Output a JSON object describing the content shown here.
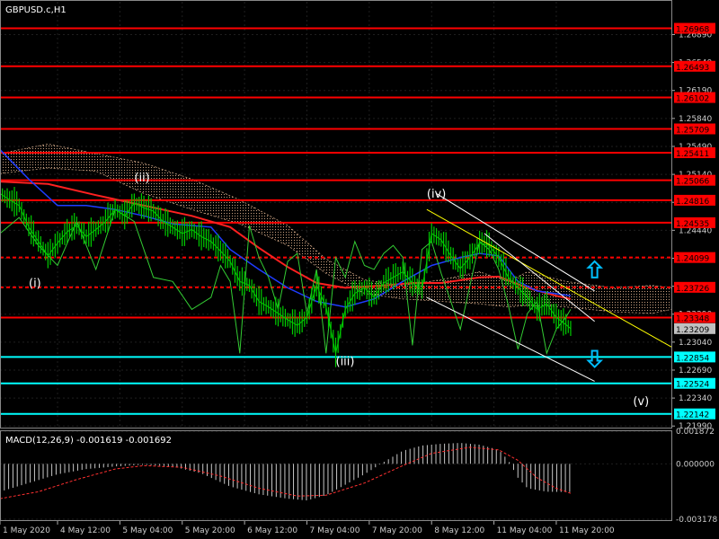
{
  "chart_data": [
    {
      "type": "line",
      "title": "GBPUSD.c,H1",
      "ylim": [
        1.2197,
        1.273
      ],
      "y_ticks": [
        1.2689,
        1.2654,
        1.2619,
        1.2584,
        1.2549,
        1.2514,
        1.2479,
        1.2444,
        1.2409,
        1.2374,
        1.2339,
        1.2304,
        1.2269,
        1.2234,
        1.2199
      ],
      "price_levels": {
        "red": [
          1.26968,
          1.26493,
          1.26102,
          1.25709,
          1.25411,
          1.25066,
          1.24816,
          1.24535,
          1.24099,
          1.23726,
          1.23348
        ],
        "cyan": [
          1.22854,
          1.22524,
          1.22142
        ]
      },
      "current_price": 1.23209,
      "wave_labels": [
        {
          "text": "(i)",
          "x": 6,
          "y": 1.2373
        },
        {
          "text": "(ii)",
          "x": 28,
          "y": 1.2505
        },
        {
          "text": "(iii)",
          "x": 70,
          "y": 1.2275
        },
        {
          "text": "(iv)",
          "x": 89,
          "y": 1.2485
        },
        {
          "text": "(v)",
          "x": 132,
          "y": 1.2225
        }
      ],
      "arrows": [
        {
          "direction": "up",
          "x": 124,
          "y": 1.2395
        },
        {
          "direction": "down",
          "x": 124,
          "y": 1.2283
        }
      ],
      "price_series": [
        [
          0,
          1.249
        ],
        [
          2,
          1.2482
        ],
        [
          4,
          1.2475
        ],
        [
          6,
          1.2448
        ],
        [
          8,
          1.243
        ],
        [
          10,
          1.2412
        ],
        [
          12,
          1.2428
        ],
        [
          14,
          1.2442
        ],
        [
          16,
          1.245
        ],
        [
          18,
          1.2436
        ],
        [
          20,
          1.2445
        ],
        [
          22,
          1.2455
        ],
        [
          24,
          1.247
        ],
        [
          26,
          1.2462
        ],
        [
          28,
          1.2478
        ],
        [
          30,
          1.2472
        ],
        [
          32,
          1.2468
        ],
        [
          34,
          1.2455
        ],
        [
          36,
          1.2448
        ],
        [
          38,
          1.244
        ],
        [
          40,
          1.2445
        ],
        [
          42,
          1.2436
        ],
        [
          44,
          1.243
        ],
        [
          46,
          1.2418
        ],
        [
          48,
          1.2405
        ],
        [
          50,
          1.238
        ],
        [
          52,
          1.2375
        ],
        [
          54,
          1.2355
        ],
        [
          56,
          1.2348
        ],
        [
          58,
          1.234
        ],
        [
          60,
          1.2332
        ],
        [
          62,
          1.2325
        ],
        [
          64,
          1.2335
        ],
        [
          66,
          1.2375
        ],
        [
          68,
          1.2348
        ],
        [
          70,
          1.229
        ],
        [
          72,
          1.2345
        ],
        [
          74,
          1.2365
        ],
        [
          76,
          1.2372
        ],
        [
          78,
          1.236
        ],
        [
          80,
          1.2378
        ],
        [
          82,
          1.2385
        ],
        [
          84,
          1.2392
        ],
        [
          86,
          1.2378
        ],
        [
          88,
          1.237
        ],
        [
          90,
          1.244
        ],
        [
          92,
          1.2432
        ],
        [
          94,
          1.2412
        ],
        [
          96,
          1.2396
        ],
        [
          98,
          1.241
        ],
        [
          100,
          1.2428
        ],
        [
          102,
          1.2425
        ],
        [
          104,
          1.241
        ],
        [
          106,
          1.2385
        ],
        [
          108,
          1.2372
        ],
        [
          110,
          1.236
        ],
        [
          112,
          1.2345
        ],
        [
          114,
          1.2352
        ],
        [
          116,
          1.2335
        ],
        [
          118,
          1.2326
        ],
        [
          119,
          1.2321
        ]
      ],
      "osc_series": [
        [
          0,
          1.244
        ],
        [
          4,
          1.246
        ],
        [
          8,
          1.2425
        ],
        [
          12,
          1.24
        ],
        [
          16,
          1.2455
        ],
        [
          20,
          1.2395
        ],
        [
          24,
          1.247
        ],
        [
          28,
          1.2455
        ],
        [
          32,
          1.2385
        ],
        [
          36,
          1.238
        ],
        [
          40,
          1.2345
        ],
        [
          44,
          1.236
        ],
        [
          46,
          1.24
        ],
        [
          48,
          1.238
        ],
        [
          50,
          1.229
        ],
        [
          52,
          1.245
        ],
        [
          54,
          1.241
        ],
        [
          56,
          1.2385
        ],
        [
          58,
          1.2345
        ],
        [
          60,
          1.2405
        ],
        [
          62,
          1.2415
        ],
        [
          64,
          1.234
        ],
        [
          66,
          1.2395
        ],
        [
          68,
          1.229
        ],
        [
          70,
          1.241
        ],
        [
          72,
          1.2385
        ],
        [
          74,
          1.243
        ],
        [
          76,
          1.24
        ],
        [
          78,
          1.2395
        ],
        [
          80,
          1.2415
        ],
        [
          82,
          1.2425
        ],
        [
          84,
          1.241
        ],
        [
          86,
          1.23
        ],
        [
          88,
          1.242
        ],
        [
          90,
          1.243
        ],
        [
          92,
          1.239
        ],
        [
          94,
          1.2355
        ],
        [
          96,
          1.232
        ],
        [
          98,
          1.2375
        ],
        [
          100,
          1.243
        ],
        [
          102,
          1.242
        ],
        [
          104,
          1.2395
        ],
        [
          106,
          1.235
        ],
        [
          108,
          1.2295
        ],
        [
          110,
          1.234
        ],
        [
          112,
          1.2355
        ],
        [
          114,
          1.229
        ],
        [
          116,
          1.232
        ],
        [
          118,
          1.2335
        ],
        [
          119,
          1.2345
        ]
      ],
      "ma_slow": [
        [
          0,
          1.2505
        ],
        [
          10,
          1.2502
        ],
        [
          20,
          1.2488
        ],
        [
          30,
          1.2475
        ],
        [
          40,
          1.2462
        ],
        [
          48,
          1.2448
        ],
        [
          54,
          1.2422
        ],
        [
          60,
          1.2398
        ],
        [
          66,
          1.2378
        ],
        [
          72,
          1.2372
        ],
        [
          80,
          1.2375
        ],
        [
          86,
          1.2378
        ],
        [
          92,
          1.2378
        ],
        [
          100,
          1.2385
        ],
        [
          104,
          1.2386
        ],
        [
          110,
          1.2372
        ],
        [
          116,
          1.2362
        ],
        [
          119,
          1.2358
        ]
      ],
      "ma_fast": [
        [
          0,
          1.2545
        ],
        [
          6,
          1.2508
        ],
        [
          12,
          1.2475
        ],
        [
          18,
          1.2475
        ],
        [
          24,
          1.247
        ],
        [
          30,
          1.2462
        ],
        [
          36,
          1.2452
        ],
        [
          44,
          1.2448
        ],
        [
          48,
          1.242
        ],
        [
          54,
          1.2395
        ],
        [
          60,
          1.2372
        ],
        [
          66,
          1.2355
        ],
        [
          72,
          1.2348
        ],
        [
          78,
          1.2358
        ],
        [
          84,
          1.238
        ],
        [
          90,
          1.24
        ],
        [
          96,
          1.241
        ],
        [
          100,
          1.2415
        ],
        [
          104,
          1.2412
        ],
        [
          108,
          1.238
        ],
        [
          112,
          1.2368
        ],
        [
          119,
          1.2362
        ]
      ],
      "cloud_a": [
        [
          0,
          1.254
        ],
        [
          10,
          1.2552
        ],
        [
          20,
          1.254
        ],
        [
          30,
          1.2528
        ],
        [
          40,
          1.2508
        ],
        [
          50,
          1.2482
        ],
        [
          60,
          1.245
        ],
        [
          68,
          1.2408
        ],
        [
          76,
          1.2382
        ],
        [
          84,
          1.2375
        ],
        [
          92,
          1.2382
        ],
        [
          100,
          1.2392
        ],
        [
          106,
          1.238
        ],
        [
          110,
          1.2392
        ],
        [
          118,
          1.238
        ],
        [
          128,
          1.2372
        ],
        [
          136,
          1.2375
        ],
        [
          140,
          1.2372
        ]
      ],
      "cloud_b": [
        [
          0,
          1.2515
        ],
        [
          10,
          1.2522
        ],
        [
          20,
          1.2518
        ],
        [
          30,
          1.249
        ],
        [
          40,
          1.247
        ],
        [
          50,
          1.2452
        ],
        [
          60,
          1.2425
        ],
        [
          68,
          1.239
        ],
        [
          76,
          1.2365
        ],
        [
          84,
          1.2358
        ],
        [
          92,
          1.2355
        ],
        [
          100,
          1.2352
        ],
        [
          106,
          1.2348
        ],
        [
          110,
          1.235
        ],
        [
          118,
          1.2348
        ],
        [
          128,
          1.2342
        ],
        [
          136,
          1.234
        ],
        [
          140,
          1.2345
        ]
      ],
      "channels": [
        {
          "color": "#ffff00",
          "from": [
            89,
            1.247
          ],
          "to": [
            140,
            1.2298
          ]
        },
        {
          "color": "#ffffff",
          "from": [
            91,
            1.249
          ],
          "to": [
            124,
            1.2368
          ]
        },
        {
          "color": "#ffffff",
          "from": [
            101,
            1.244
          ],
          "to": [
            124,
            1.233
          ]
        },
        {
          "color": "#ffffff",
          "from": [
            89,
            1.236
          ],
          "to": [
            124,
            1.2255
          ]
        }
      ]
    },
    {
      "type": "bar",
      "title": "MACD(12,26,9) -0.001619 -0.001692",
      "ylim": [
        -0.003178,
        0.001872
      ],
      "y_ticks": [
        0.001872,
        0.0,
        -0.003178
      ],
      "y_tick_labels": [
        "0.001872",
        "0.000000",
        "-0.003178"
      ],
      "macd": [
        [
          0,
          -0.0016
        ],
        [
          6,
          -0.0011
        ],
        [
          12,
          -0.0006
        ],
        [
          18,
          -0.0003
        ],
        [
          24,
          -0.00015
        ],
        [
          30,
          -5e-05
        ],
        [
          36,
          -0.00015
        ],
        [
          42,
          -0.00055
        ],
        [
          48,
          -0.0013
        ],
        [
          54,
          -0.00175
        ],
        [
          60,
          -0.002
        ],
        [
          64,
          -0.0021
        ],
        [
          68,
          -0.0018
        ],
        [
          72,
          -0.0012
        ],
        [
          76,
          -0.0006
        ],
        [
          80,
          0.0001
        ],
        [
          84,
          0.00075
        ],
        [
          88,
          0.00105
        ],
        [
          92,
          0.00115
        ],
        [
          96,
          0.0012
        ],
        [
          100,
          0.0011
        ],
        [
          104,
          0.0008
        ],
        [
          106,
          0.0002
        ],
        [
          108,
          -0.0008
        ],
        [
          110,
          -0.0014
        ],
        [
          114,
          -0.0016
        ],
        [
          119,
          -0.00162
        ]
      ],
      "signal": [
        [
          0,
          -0.002
        ],
        [
          8,
          -0.0016
        ],
        [
          16,
          -0.0009
        ],
        [
          24,
          -0.0003
        ],
        [
          30,
          -0.0001
        ],
        [
          38,
          -0.0002
        ],
        [
          46,
          -0.0007
        ],
        [
          54,
          -0.0014
        ],
        [
          62,
          -0.00185
        ],
        [
          68,
          -0.0018
        ],
        [
          76,
          -0.0011
        ],
        [
          84,
          -0.0001
        ],
        [
          90,
          0.0006
        ],
        [
          98,
          0.00095
        ],
        [
          104,
          0.0008
        ],
        [
          108,
          0.0002
        ],
        [
          112,
          -0.0008
        ],
        [
          116,
          -0.0014
        ],
        [
          119,
          -0.00169
        ]
      ]
    }
  ],
  "time_axis": {
    "labels": [
      "1 May 2020",
      "4 May 12:00",
      "5 May 04:00",
      "5 May 20:00",
      "6 May 12:00",
      "7 May 04:00",
      "7 May 20:00",
      "8 May 12:00",
      "11 May 04:00",
      "11 May 20:00"
    ],
    "positions": [
      0,
      12,
      25,
      38,
      51,
      64,
      77,
      90,
      103,
      116
    ]
  },
  "colors": {
    "background": "#000000",
    "red_level": "#ff0000",
    "cyan_level": "#00ffff",
    "price": "#00cc00",
    "osc": "#33cc33",
    "ma_slow": "#ff2020",
    "ma_fast": "#1e3cff",
    "cloud": "#c8a080",
    "channel_yellow": "#ffff00",
    "arrow": "#00bfff",
    "current_price": "#c0c0c0",
    "macd_bar": "#c8c8c8",
    "macd_signal": "#ff3030",
    "grid": "#1f1f1f",
    "text": "#ffffff"
  }
}
